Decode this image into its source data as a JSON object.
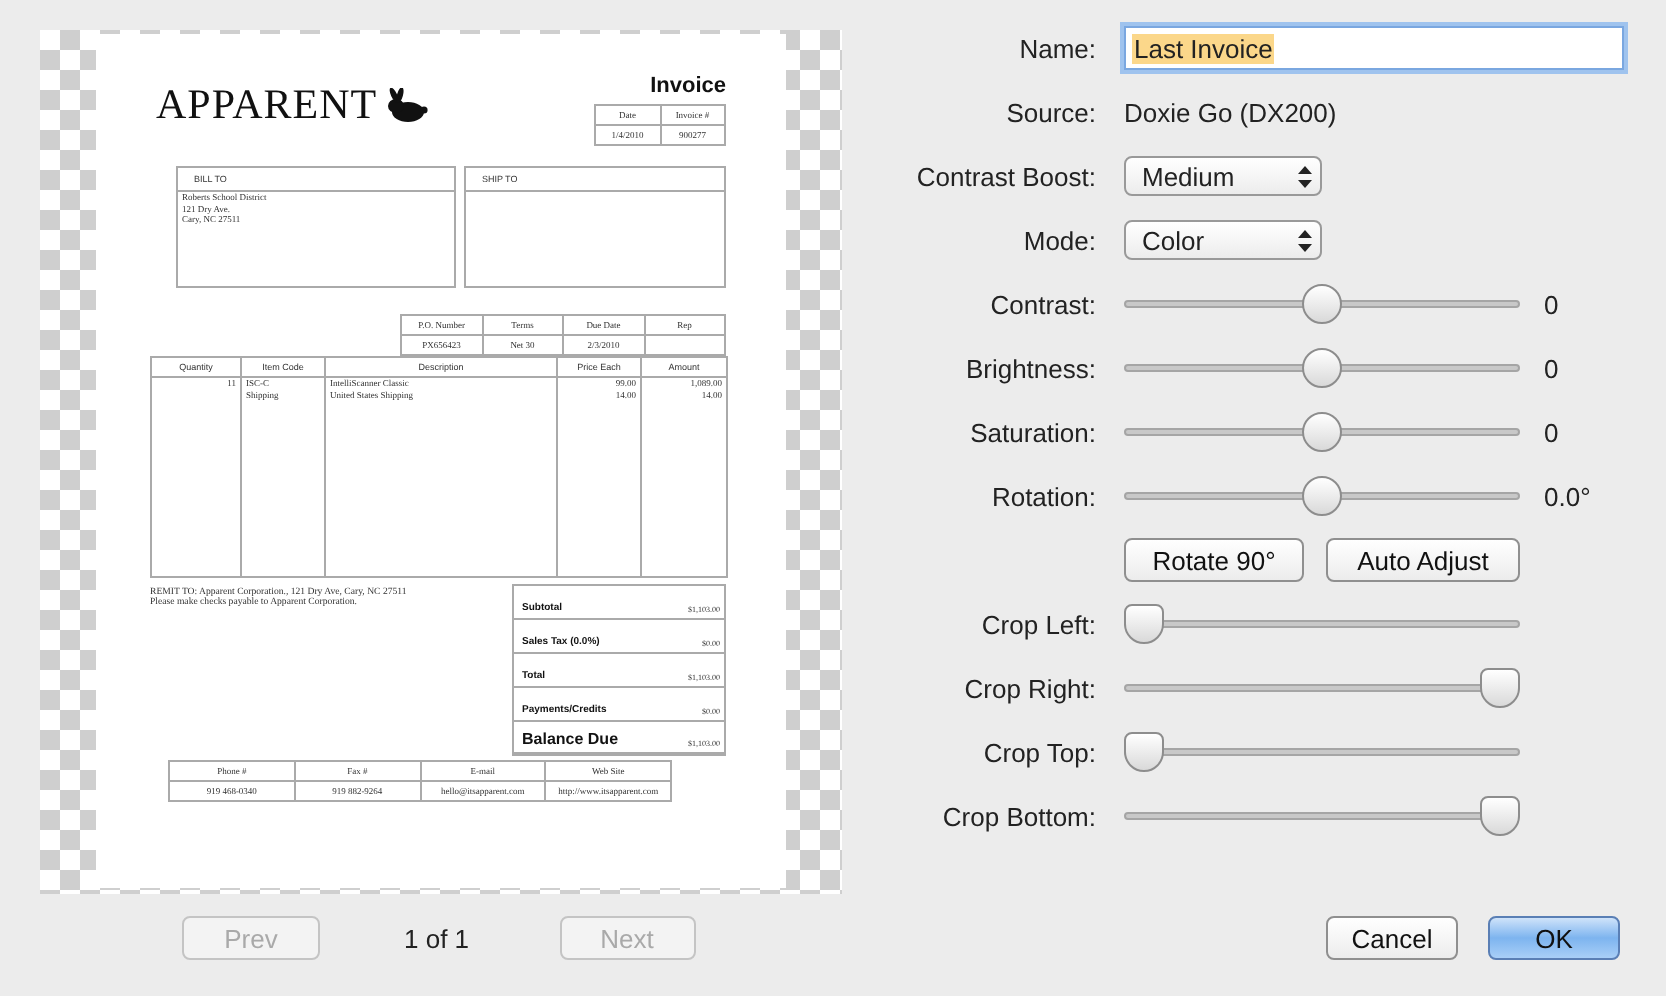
{
  "preview": {
    "document": {
      "logo": "APPARENT",
      "title": "Invoice",
      "header_table": {
        "columns": [
          "Date",
          "Invoice #"
        ],
        "row": [
          "1/4/2010",
          "900277"
        ]
      },
      "bill_to": {
        "label": "BILL TO",
        "lines": [
          "Roberts School District",
          "121 Dry Ave.",
          "Cary, NC 27511"
        ]
      },
      "ship_to": {
        "label": "SHIP TO"
      },
      "order_table": {
        "columns": [
          "P.O. Number",
          "Terms",
          "Due Date",
          "Rep"
        ],
        "row": [
          "PX656423",
          "Net 30",
          "2/3/2010"
        ]
      },
      "items_table": {
        "columns": [
          "Quantity",
          "Item Code",
          "Description",
          "Price Each",
          "Amount"
        ],
        "rows": [
          {
            "quantity": "11",
            "item_code": "ISC-C",
            "description": "IntelliScanner Classic",
            "price": "99.00",
            "amount": "1,089.00"
          },
          {
            "item_code": "Shipping",
            "description": "United States Shipping",
            "price": "14.00",
            "amount": "14.00"
          }
        ]
      },
      "remit": [
        "REMIT TO: Apparent Corporation., 121 Dry Ave, Cary, NC 27511",
        "Please make checks payable to Apparent Corporation."
      ],
      "totals": [
        {
          "label": "Subtotal",
          "value": "$1,103.00",
          "emphasis": false
        },
        {
          "label": "Sales Tax (0.0%)",
          "value": "$0.00",
          "emphasis": false
        },
        {
          "label": "Total",
          "value": "$1,103.00",
          "emphasis": false
        },
        {
          "label": "Payments/Credits",
          "value": "$0.00",
          "emphasis": false
        },
        {
          "label": "Balance Due",
          "value": "$1,103.00",
          "emphasis": true
        }
      ],
      "contact_table": {
        "columns": [
          "Phone #",
          "Fax #",
          "E-mail",
          "Web Site"
        ],
        "row": [
          "919 468-0340",
          "919 882-9264",
          "hello@itsapparent.com",
          "http://www.itsapparent.com"
        ]
      }
    },
    "pager": {
      "prev": {
        "label": "Prev",
        "disabled": true
      },
      "page": "1 of 1",
      "next": {
        "label": "Next",
        "disabled": true
      }
    }
  },
  "settings": [
    {
      "kind": "input",
      "label": "Name:",
      "value": "Last Invoice",
      "text_selected": true
    },
    {
      "kind": "text",
      "label": "Source:",
      "value": "Doxie Go (DX200)"
    },
    {
      "kind": "popup",
      "label": "Contrast Boost:",
      "value": "Medium"
    },
    {
      "kind": "popup",
      "label": "Mode:",
      "value": "Color"
    },
    {
      "kind": "slider",
      "label": "Contrast:",
      "level": 0.5,
      "reading": "0"
    },
    {
      "kind": "slider",
      "label": "Brightness:",
      "level": 0.5,
      "reading": "0"
    },
    {
      "kind": "slider",
      "label": "Saturation:",
      "level": 0.5,
      "reading": "0"
    },
    {
      "kind": "slider",
      "label": "Rotation:",
      "level": 0.5,
      "reading": "0.0°"
    },
    {
      "kind": "buttons",
      "buttons": [
        "Rotate 90°",
        "Auto Adjust"
      ]
    },
    {
      "kind": "crop-slider",
      "label": "Crop Left:",
      "level": 0
    },
    {
      "kind": "crop-slider",
      "label": "Crop Right:",
      "level": 1
    },
    {
      "kind": "crop-slider",
      "label": "Crop Top:",
      "level": 0
    },
    {
      "kind": "crop-slider",
      "label": "Crop Bottom:",
      "level": 1
    }
  ],
  "dialog_buttons": [
    {
      "label": "Cancel",
      "default": false
    },
    {
      "label": "OK",
      "default": true
    }
  ]
}
